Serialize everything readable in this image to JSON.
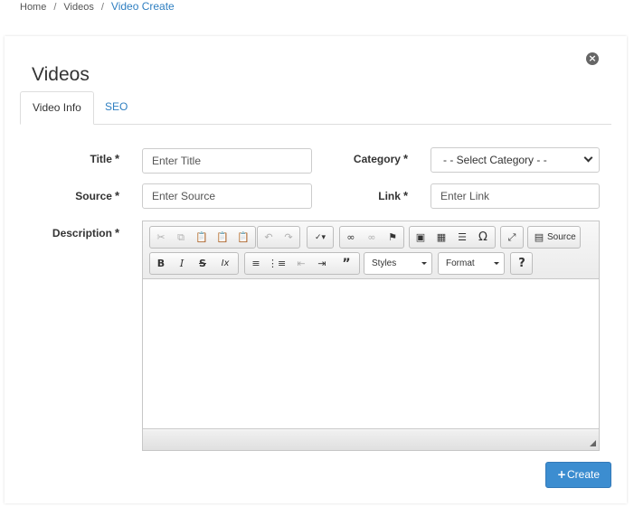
{
  "breadcrumb": {
    "home": "Home",
    "sep": "/",
    "videos": "Videos",
    "current": "Video Create"
  },
  "page": {
    "title": "Videos",
    "close_icon": "close-circle-icon"
  },
  "tabs": [
    {
      "label": "Video Info",
      "active": true
    },
    {
      "label": "SEO",
      "active": false
    }
  ],
  "form": {
    "required_mark": "*",
    "title": {
      "label": "Title",
      "placeholder": "Enter Title",
      "value": ""
    },
    "category": {
      "label": "Category",
      "selected": "- - Select Category - -"
    },
    "source": {
      "label": "Source",
      "placeholder": "Enter Source",
      "value": ""
    },
    "link": {
      "label": "Link",
      "placeholder": "Enter Link",
      "value": ""
    },
    "description": {
      "label": "Description",
      "value": ""
    }
  },
  "editor": {
    "source_label": "Source",
    "styles_label": "Styles",
    "format_label": "Format",
    "help_label": "?",
    "bold": "B",
    "italic": "I",
    "strike": "S",
    "remove_format": "Ix"
  },
  "actions": {
    "create_label": "Create",
    "create_icon": "plus-icon"
  },
  "colors": {
    "accent": "#3c8dd0",
    "link": "#2f7fc1"
  }
}
